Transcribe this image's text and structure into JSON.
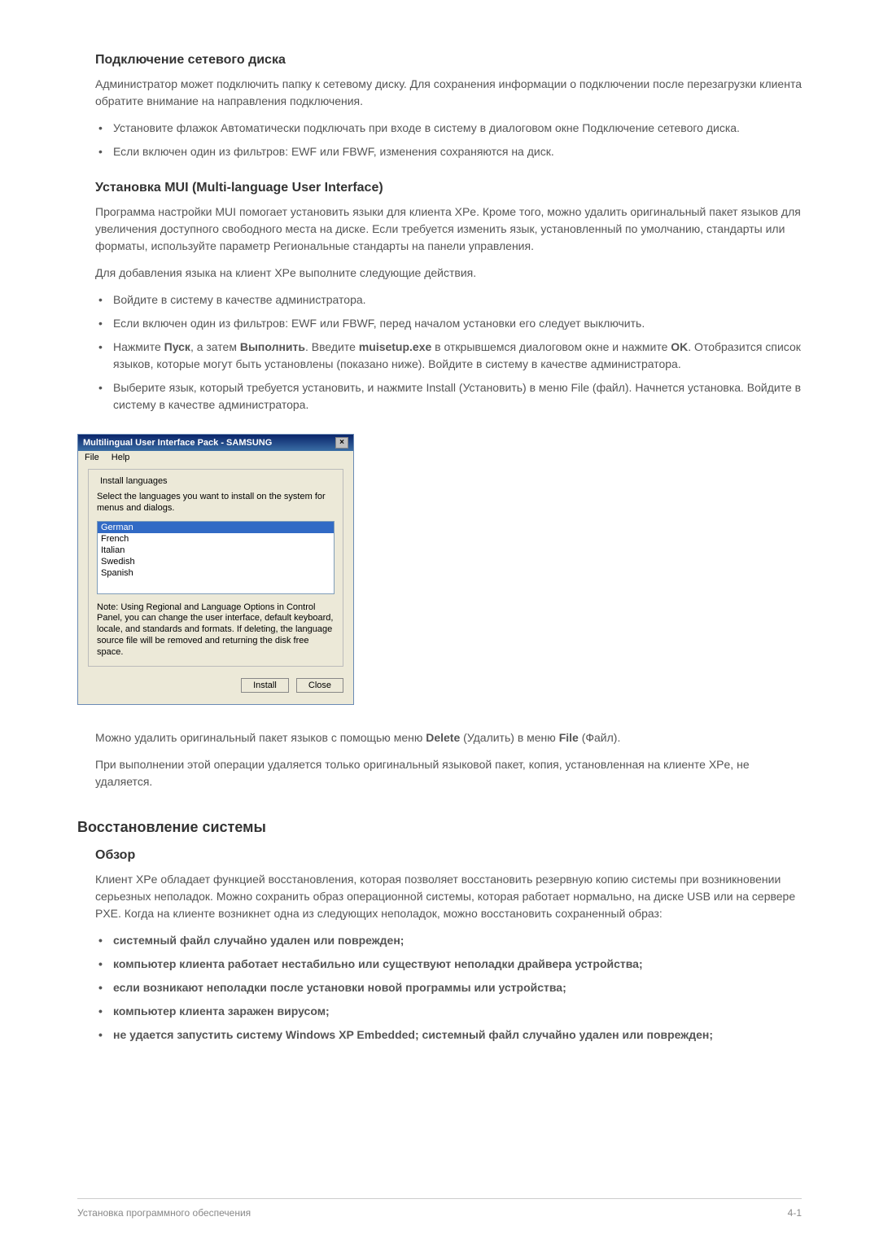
{
  "section1": {
    "heading": "Подключение сетевого диска",
    "intro": "Администратор может подключить папку к сетевому диску. Для сохранения информации о подключении после перезагрузки клиента обратите внимание на направления подключения.",
    "bullets": [
      "Установите флажок Автоматически подключать при входе в систему в диалоговом окне Подключение сетевого диска.",
      "Если включен один из фильтров: EWF или FBWF, изменения сохраняются на диск."
    ]
  },
  "section2": {
    "heading": "Установка MUI (Multi-language User Interface)",
    "p1": "Программа настройки MUI помогает установить языки для клиента XPe. Кроме того, можно удалить оригинальный пакет языков для увеличения доступного свободного места на диске. Если требуется изменить язык, установленный по умолчанию, стандарты или форматы, используйте параметр Региональные стандарты на панели управления.",
    "p2": "Для добавления языка на клиент XPe выполните следующие действия.",
    "bullets": [
      "Войдите в систему в качестве администратора.",
      "Если включен один из фильтров: EWF или FBWF, перед началом установки его следует выключить.",
      "Нажмите <b>Пуск</b>, а затем <b>Выполнить</b>. Введите <b>muisetup.exe</b> в открывшемся диалоговом окне и нажмите <b>OK</b>. Отобразится список языков, которые могут быть установлены (показано ниже). Войдите в систему в качестве администратора.",
      "Выберите язык, который требуется установить, и нажмите Install (Установить) в меню File (файл). Начнется установка. Войдите в систему в качестве администратора."
    ]
  },
  "dialog": {
    "title": "Multilingual User Interface Pack - SAMSUNG",
    "menu": {
      "file": "File",
      "help": "Help"
    },
    "fieldset_label": "Install languages",
    "desc": "Select the languages you want to install on the system for menus and dialogs.",
    "languages": [
      "German",
      "French",
      "Italian",
      "Swedish",
      "Spanish"
    ],
    "note": "Note: Using Regional and Language Options in Control Panel, you can change the user interface, default keyboard, locale, and standards and formats. If deleting, the language source file will be removed and returning the disk free space.",
    "install_btn": "Install",
    "close_btn": "Close"
  },
  "after_dialog": {
    "p1": "Можно удалить оригинальный пакет языков с помощью меню <b>Delete</b> (Удалить) в меню <b>File</b> (Файл).",
    "p2": "При выполнении этой операции удаляется только оригинальный языковой пакет, копия, установленная на клиенте XPe, не удаляется."
  },
  "section3": {
    "main_heading": "Восстановление системы",
    "sub_heading": "Обзор",
    "intro": "Клиент XPe обладает функцией восстановления, которая позволяет восстановить резервную копию системы при возникновении серьезных неполадок. Можно сохранить образ операционной системы, которая работает нормально, на диске USB или на сервере PXE. Когда на клиенте возникнет одна из следующих неполадок, можно восстановить сохраненный образ:",
    "bullets": [
      "системный файл случайно удален или поврежден;",
      " компьютер клиента работает нестабильно или существуют неполадки драйвера устройства;",
      "если возникают неполадки после установки новой программы или устройства;",
      "компьютер клиента заражен вирусом;",
      "не удается запустить систему Windows XP Embedded; системный файл случайно удален или поврежден;"
    ]
  },
  "footer": {
    "left": "Установка программного обеспечения",
    "right": "4-1"
  }
}
